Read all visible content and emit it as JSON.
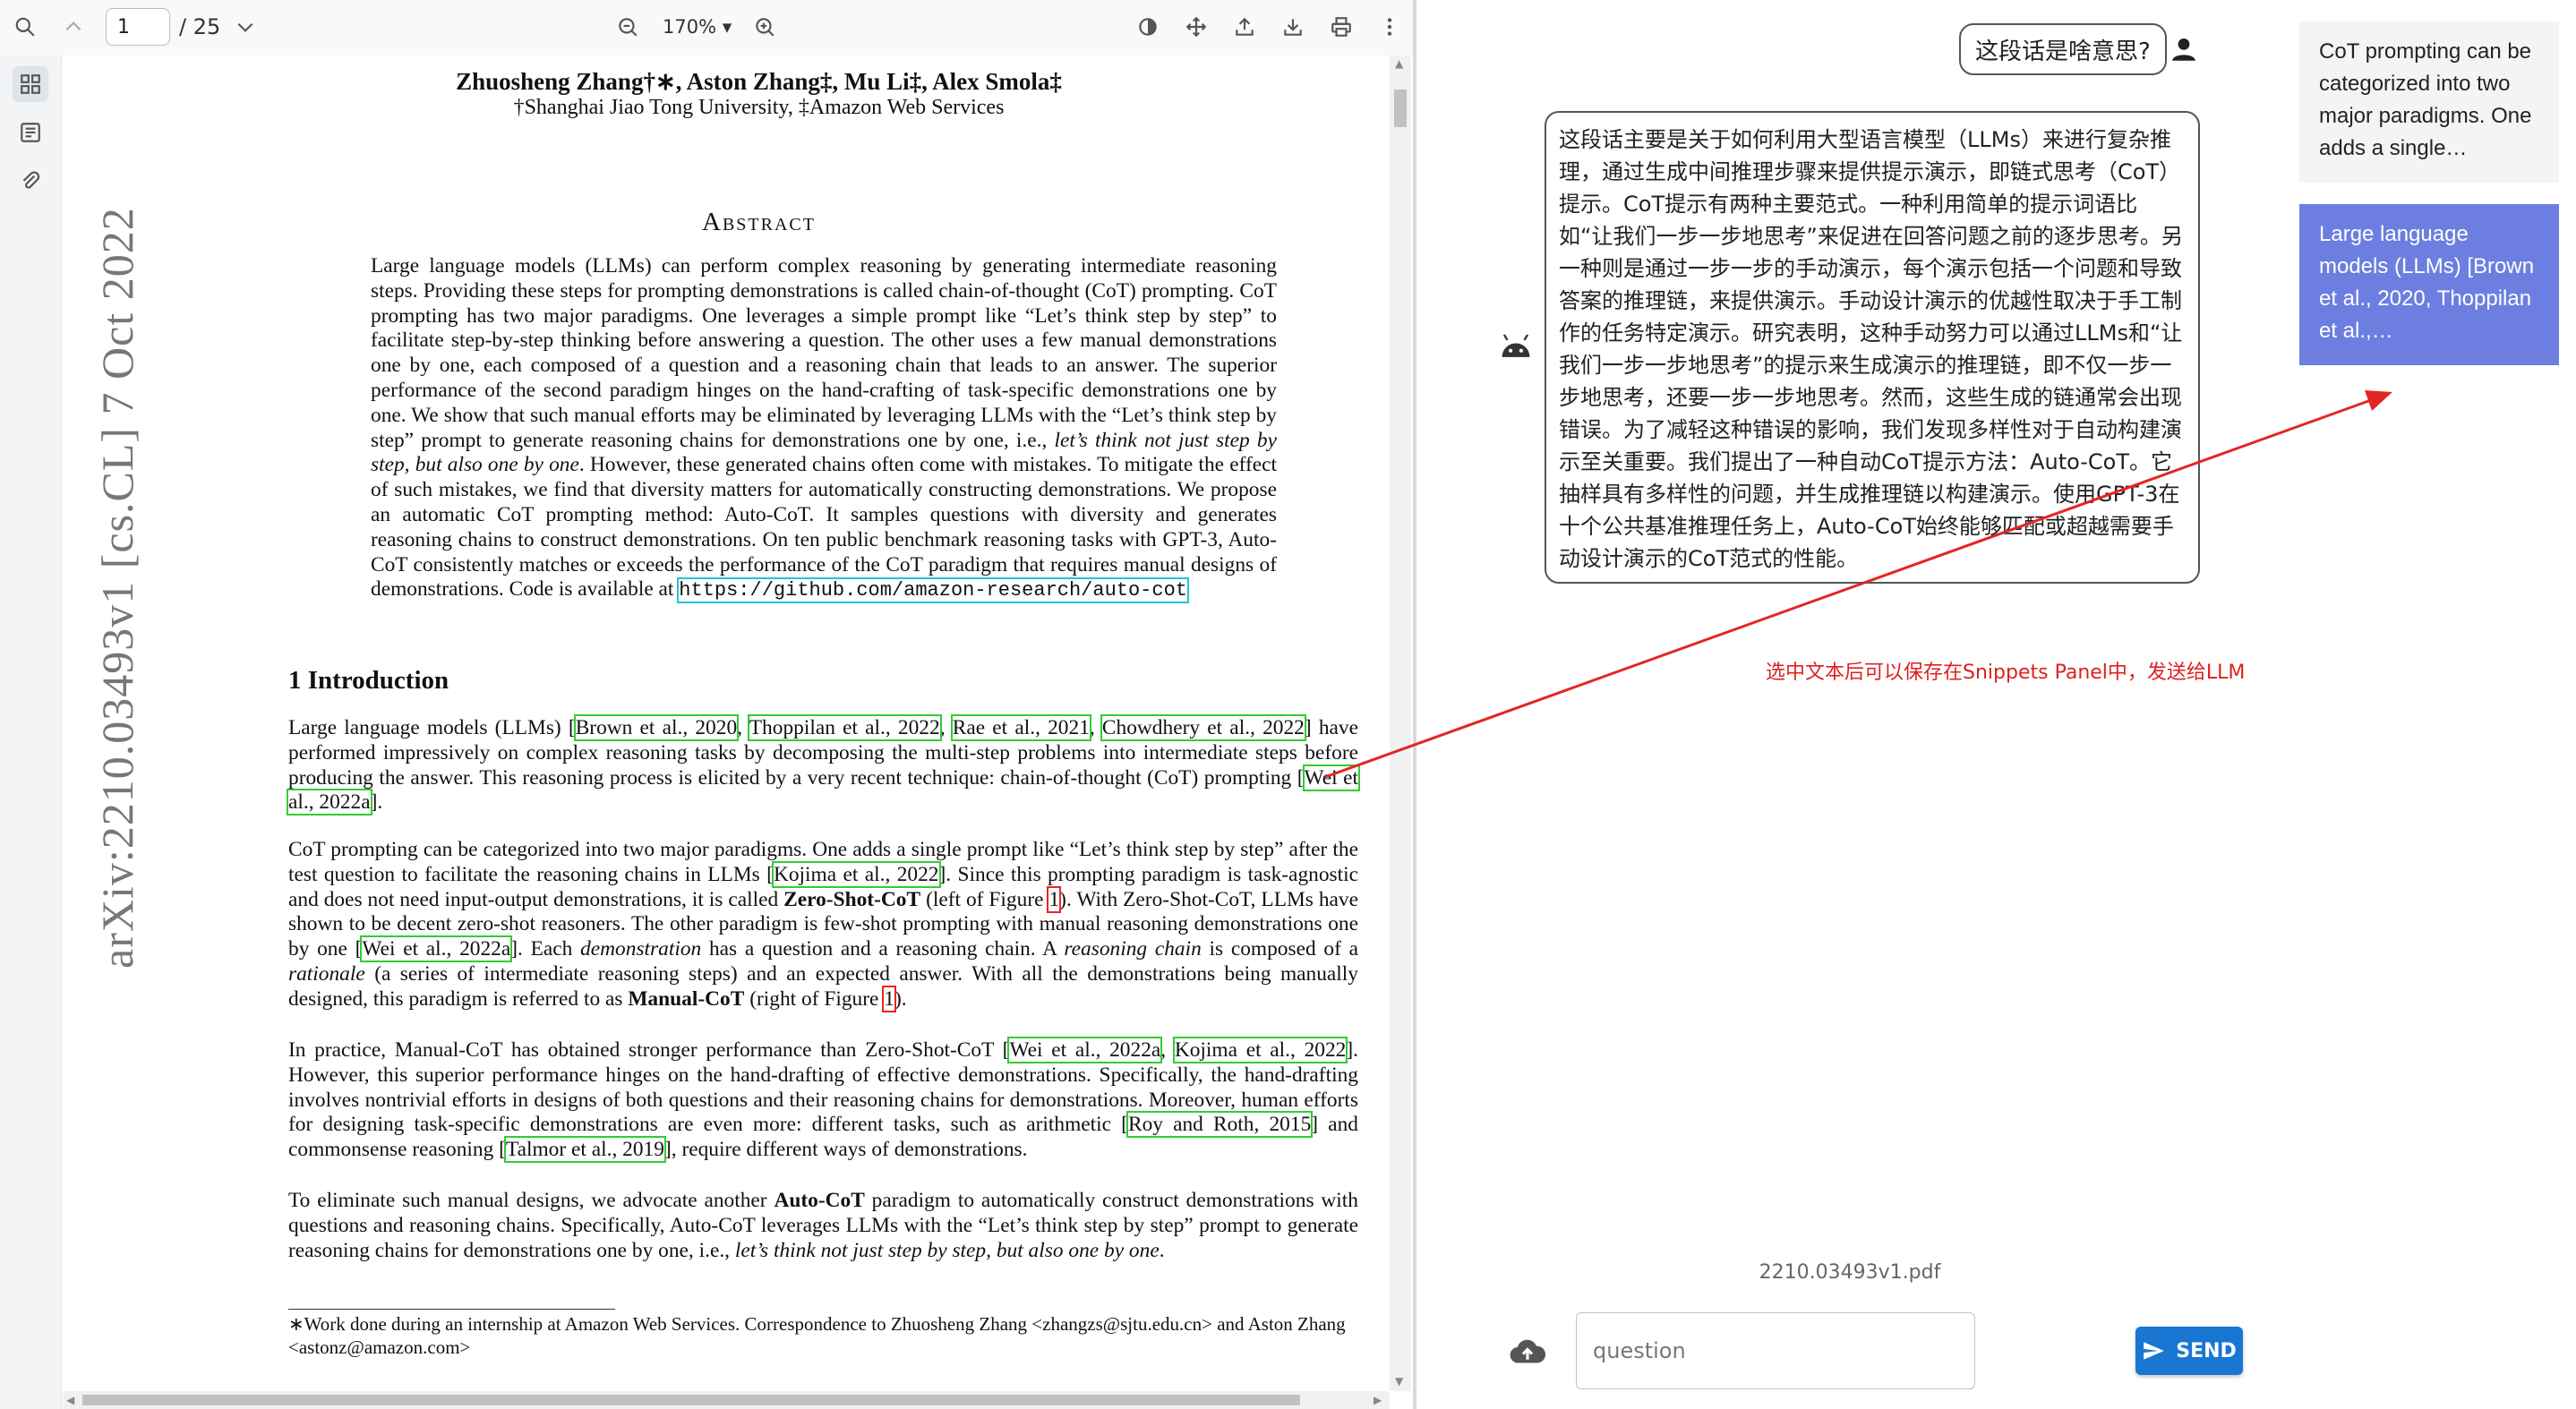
{
  "pdf_viewer": {
    "toolbar": {
      "page_number": "1",
      "page_total": "/ 25",
      "zoom_level": "170% ▾"
    },
    "page": {
      "arxiv_stamp": "arXiv:2210.03493v1  [cs.CL]  7 Oct 2022",
      "authors": "Zhuosheng Zhang†∗, Aston Zhang‡, Mu Li‡, Alex Smola‡",
      "affiliations": "†Shanghai Jiao Tong University, ‡Amazon Web Services",
      "abstract_title": "Abstract",
      "abstract_text": "Large language models (LLMs) can perform complex reasoning by generating intermediate reasoning steps. Providing these steps for prompting demonstrations is called chain-of-thought (CoT) prompting. CoT prompting has two major paradigms. One leverages a simple prompt like “Let’s think step by step” to facilitate step-by-step thinking before answering a question. The other uses a few manual demonstrations one by one, each composed of a question and a reasoning chain that leads to an answer. The superior performance of the second paradigm hinges on the hand-crafting of task-specific demonstrations one by one. We show that such manual efforts may be eliminated by leveraging LLMs with the “Let’s think step by step” prompt to generate reasoning chains for demonstrations one by one, i.e.,",
      "abstract_italic": "let’s think not just step by step, but also one by one",
      "abstract_text_2": ". However, these generated chains often come with mistakes. To mitigate the effect of such mistakes, we find that diversity matters for automatically constructing demonstrations. We propose an automatic CoT prompting method: Auto-CoT. It samples questions with diversity and generates reasoning chains to construct demonstrations. On ten public benchmark reasoning tasks with GPT-3, Auto-CoT consistently matches or exceeds the performance of the CoT paradigm that requires manual designs of demonstrations. Code is available at",
      "code_link": "https://github.com/amazon-research/auto-cot",
      "intro_heading": "1    Introduction",
      "p1": {
        "t1": "Large language models (LLMs) [",
        "c1": "Brown et al., 2020",
        "c2": "Thoppilan et al., 2022",
        "c3": "Rae et al., 2021",
        "c4": "Chowdhery et al., 2022",
        "t2": "] have performed impressively on complex reasoning tasks by decomposing the multi-step problems into intermediate steps before producing the answer. This reasoning process is elicited by a very recent technique: chain-of-thought (CoT) prompting [",
        "c5": "Wei et al., 2022a",
        "t3": "]."
      },
      "p2": {
        "t1": "CoT prompting can be categorized into two major paradigms. One adds a single prompt like “Let’s think step by step” after the test question to facilitate the reasoning chains in LLMs [",
        "c1": "Kojima et al., 2022",
        "t2": "]. Since this prompting paradigm is task-agnostic and does not need input-output demonstrations, it is called",
        "b1": "Zero-Shot-CoT",
        "t3": "(left of Figure",
        "r1": "1",
        "t4": "). With Zero-Shot-CoT, LLMs have shown to be decent zero-shot reasoners. The other paradigm is few-shot prompting with manual reasoning demonstrations one by one [",
        "c2": "Wei et al., 2022a",
        "t5": "]. Each",
        "i1": "demonstration",
        "t6": "has a question and a reasoning chain. A",
        "i2": "reasoning chain",
        "t7": "is composed of a",
        "i3": "rationale",
        "t8": "(a series of intermediate reasoning steps) and an expected answer. With all the demonstrations being manually designed, this paradigm is referred to as",
        "b2": "Manual-CoT",
        "t9": "(right of Figure",
        "r2": "1",
        "t10": ")."
      },
      "p3": {
        "t1": "In practice, Manual-CoT has obtained stronger performance than Zero-Shot-CoT [",
        "c1": "Wei et al., 2022a",
        "c2": "Kojima et al., 2022",
        "t2": "]. However, this superior performance hinges on the hand-drafting of effective demonstrations. Specifically, the hand-drafting involves nontrivial efforts in designs of both questions and their reasoning chains for demonstrations. Moreover, human efforts for designing task-specific demonstrations are even more: different tasks, such as arithmetic [",
        "c3": "Roy and Roth, 2015",
        "t3": "] and commonsense reasoning [",
        "c4": "Talmor et al., 2019",
        "t4": "], require different ways of demonstrations."
      },
      "p4": {
        "t1": "To eliminate such manual designs, we advocate another",
        "b1": "Auto-CoT",
        "t2": "paradigm to automatically construct demonstrations with questions and reasoning chains. Specifically, Auto-CoT leverages LLMs with the “Let’s think step by step” prompt to generate reasoning chains for demonstrations one by one, i.e.,",
        "i1": "let’s think not just step by step, but also one by one",
        "t3": "."
      },
      "footnote": "∗Work done during an internship at Amazon Web Services. Correspondence to Zhuosheng Zhang <zhangzs@sjtu.edu.cn> and Aston Zhang <astonz@amazon.com>"
    }
  },
  "chat": {
    "user_message": "这段话是啥意思?",
    "bot_message": "这段话主要是关于如何利用大型语言模型（LLMs）来进行复杂推理，通过生成中间推理步骤来提供提示演示，即链式思考（CoT）提示。CoT提示有两种主要范式。一种利用简单的提示词语比如“让我们一步一步地思考”来促进在回答问题之前的逐步思考。另一种则是通过一步一步的手动演示，每个演示包括一个问题和导致答案的推理链，来提供演示。手动设计演示的优越性取决于手工制作的任务特定演示。研究表明，这种手动努力可以通过LLMs和“让我们一步一步地思考”的提示来生成演示的推理链，即不仅一步一步地思考，还要一步一步地思考。然而，这些生成的链通常会出现错误。为了减轻这种错误的影响，我们发现多样性对于自动构建演示至关重要。我们提出了一种自动CoT提示方法：Auto-CoT。它抽样具有多样性的问题，并生成推理链以构建演示。使用GPT-3在十个公共基准推理任务上，Auto-CoT始终能够匹配或超越需要手动设计演示的CoT范式的性能。",
    "annotation": "选中文本后可以保存在Snippets Panel中，发送给LLM",
    "filename": "2210.03493v1.pdf",
    "input_placeholder": "question",
    "send_label": "SEND"
  },
  "snippets": [
    {
      "text": "CoT prompting can be categorized into two major paradigms. One adds a single…"
    },
    {
      "text": "Large language models (LLMs) [Brown et al., 2020, Thoppilan et al.,…"
    }
  ],
  "colors": {
    "accent": "#1976d2",
    "selected_snippet": "#6c7ee0",
    "annotation": "#e02020",
    "citation_box": "#33cc33",
    "figure_ref_box": "#ee2222",
    "link_box": "#22c3d6"
  }
}
